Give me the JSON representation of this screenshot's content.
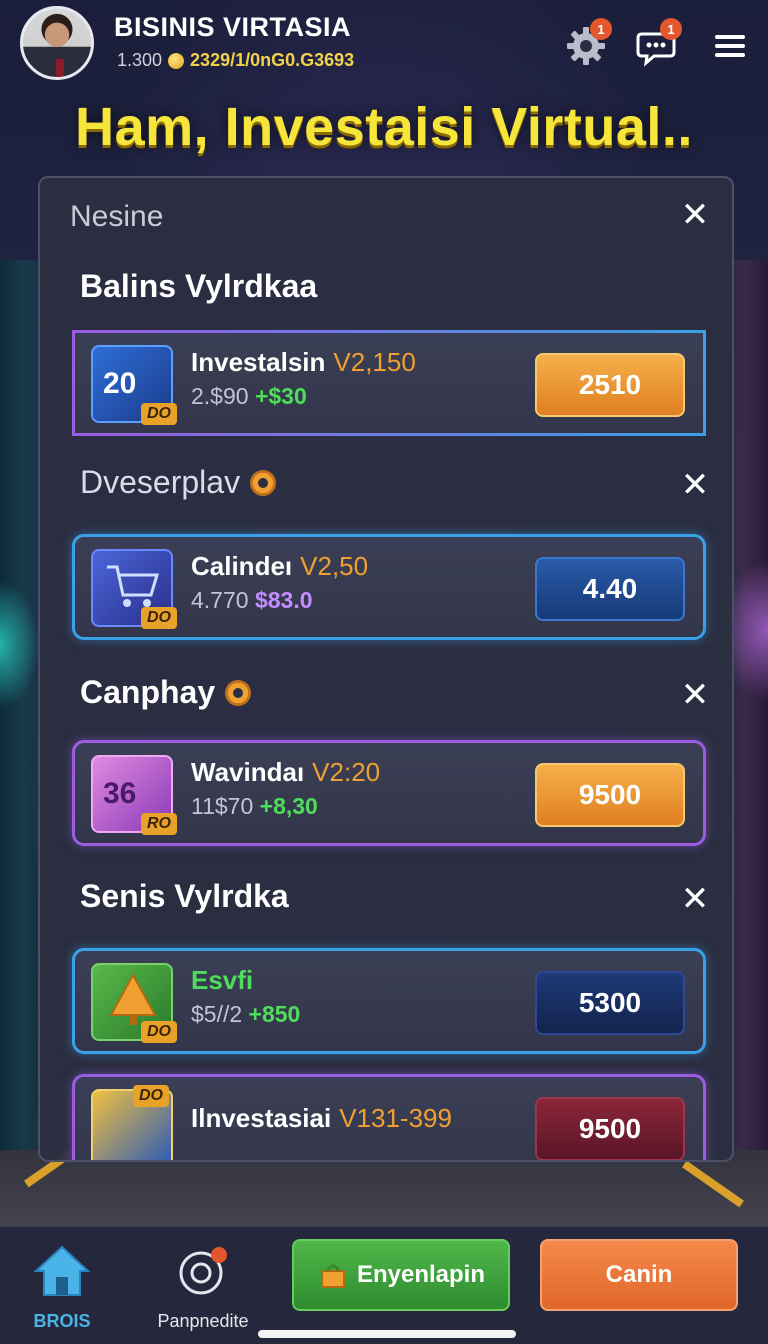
{
  "header": {
    "app_title": "BISINIS VIRTASIA",
    "balance_level": "1.300",
    "balance_coins": "2329/1/0nG0.G3693",
    "settings_badge": "1",
    "chat_badge": "1"
  },
  "headline": "Ham, Investaisi Virtual..",
  "panel": {
    "title": "Nesine",
    "close_symbol": "✕",
    "sections": [
      {
        "label": "Balins Vylrdkaa",
        "items": [
          {
            "name": "Investalsin",
            "price": "V2,150",
            "sub_base": "2.$90",
            "sub_gain": "+$30",
            "value": "2510",
            "thumb_text": "20",
            "thumb_tag": "DO"
          }
        ]
      },
      {
        "label": "Dveserplav",
        "items": [
          {
            "name": "Calindeı",
            "price": "V2,50",
            "sub_base": "4.770",
            "sub_gain": "$83.0",
            "value": "4.40",
            "thumb_tag": "DO"
          }
        ]
      },
      {
        "label": "Canphay",
        "items": [
          {
            "name": "Wavindaı",
            "price": "V2:20",
            "sub_base": "11$70",
            "sub_gain": "+8,30",
            "value": "9500",
            "thumb_text": "36",
            "thumb_tag": "RO"
          }
        ]
      },
      {
        "label": "Senis Vylrdka",
        "items": [
          {
            "name": "Esvfi",
            "price": "",
            "sub_base": "$5//2",
            "sub_gain": "+850",
            "value": "5300",
            "thumb_tag": "DO"
          },
          {
            "name": "Ilnvestasiai",
            "price": "V131-399",
            "sub_base": "",
            "sub_gain": "",
            "value": "9500",
            "thumb_tag": "DO"
          }
        ]
      }
    ]
  },
  "bottom_nav": {
    "home_label": "BROIS",
    "predict_label": "Panpnedite",
    "primary_action": "Enyenlapin",
    "secondary_action": "Canin"
  },
  "colors": {
    "headline": "#f6e53a",
    "price": "#f0a030",
    "gain_green": "#4fdc5a",
    "gain_purple": "#c48cff",
    "home_active": "#4ab3e8"
  },
  "icons": [
    "gear-icon",
    "chat-bubble-icon",
    "hamburger-menu-icon",
    "close-icon",
    "home-icon",
    "predict-icon",
    "shopping-bag-icon",
    "star-badge-icon"
  ]
}
